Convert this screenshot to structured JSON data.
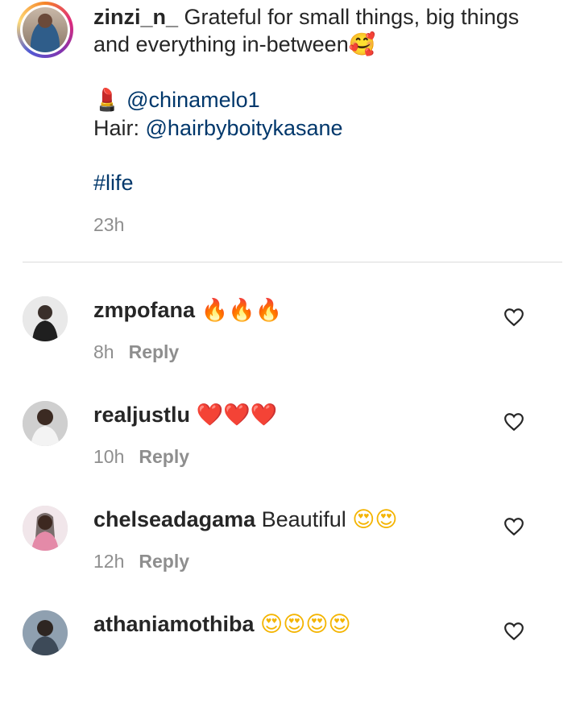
{
  "post": {
    "username": "zinzi_n_",
    "caption_line1": " Grateful for small things, big things",
    "caption_line2": "and everything in-between",
    "caption_emoji": "🥰",
    "makeup_emoji": "💄",
    "makeup_mention": "@chinamelo1",
    "hair_label": "Hair: ",
    "hair_mention": "@hairbyboitykasane",
    "hashtag": "#life",
    "time": "23h"
  },
  "comments": [
    {
      "username": "zmpofana",
      "text": "",
      "emoji": "🔥🔥🔥",
      "time": "8h",
      "reply": "Reply"
    },
    {
      "username": "realjustlu",
      "text": "",
      "emoji": "❤️❤️❤️",
      "time": "10h",
      "reply": "Reply"
    },
    {
      "username": "chelseadagama",
      "text": "Beautiful ",
      "emoji": "😍😍",
      "time": "12h",
      "reply": "Reply"
    },
    {
      "username": "athaniamothiba",
      "text": "",
      "emoji": "😍😍😍😍",
      "time": "",
      "reply": ""
    }
  ],
  "icons": {
    "like": "heart-outline-icon"
  },
  "colors": {
    "mention": "#00376b",
    "secondary_text": "#8e8e8e",
    "divider": "#dbdbdb"
  }
}
